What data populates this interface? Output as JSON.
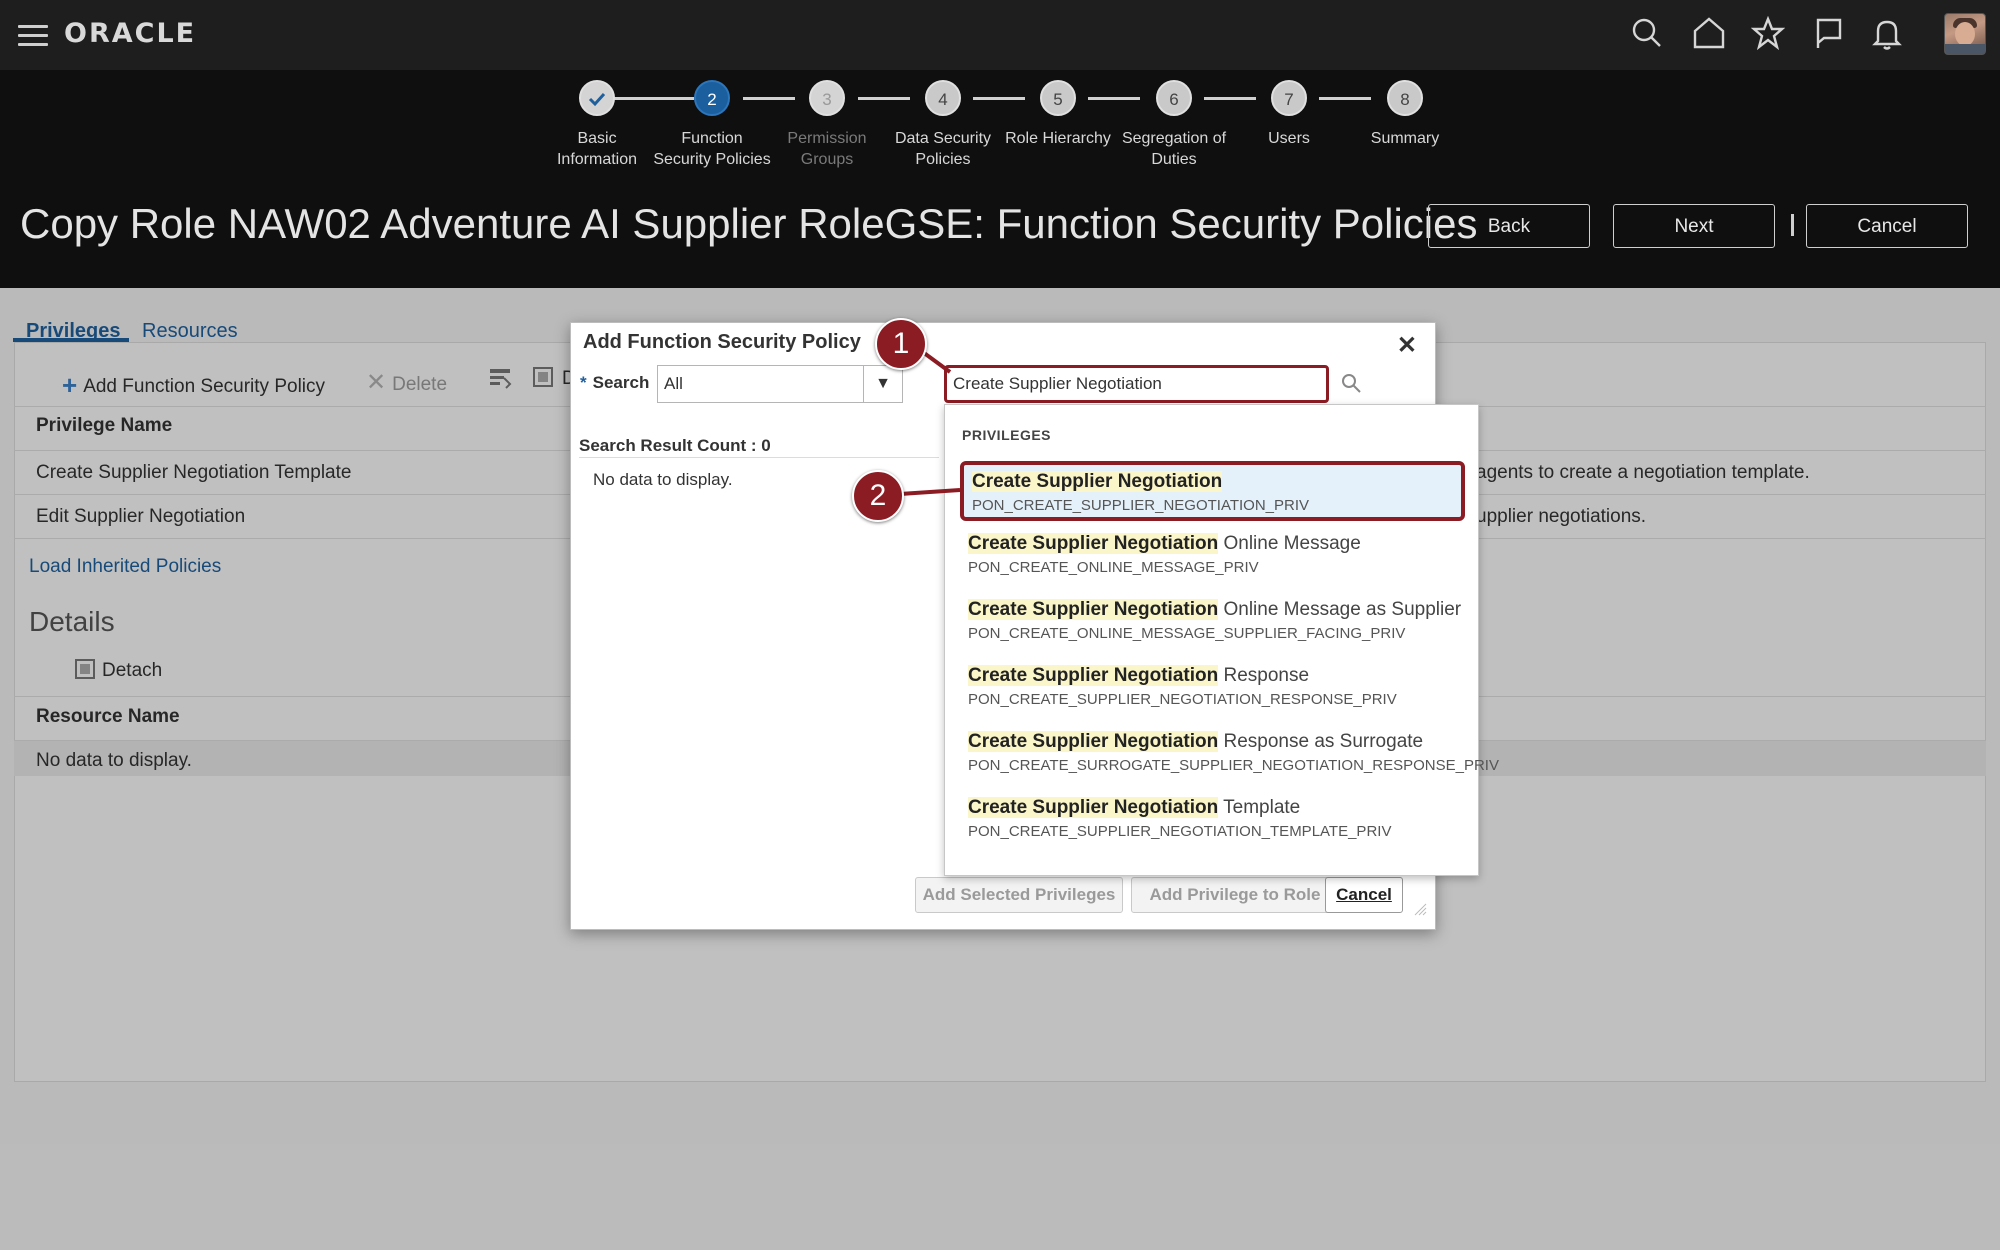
{
  "topbar": {
    "logo": "ORACLE",
    "icons": [
      "hamburger-menu-icon",
      "search-icon",
      "home-icon",
      "star-icon",
      "flag-icon",
      "bell-icon",
      "user-avatar"
    ]
  },
  "train": {
    "steps": [
      {
        "num": "",
        "label1": "Basic",
        "label2": "Information",
        "state": "done"
      },
      {
        "num": "2",
        "label1": "Function",
        "label2": "Security Policies",
        "state": "active"
      },
      {
        "num": "3",
        "label1": "Permission",
        "label2": "Groups",
        "state": "disabled"
      },
      {
        "num": "4",
        "label1": "Data Security",
        "label2": "Policies",
        "state": "normal"
      },
      {
        "num": "5",
        "label1": "Role Hierarchy",
        "label2": "",
        "state": "normal"
      },
      {
        "num": "6",
        "label1": "Segregation of",
        "label2": "Duties",
        "state": "normal"
      },
      {
        "num": "7",
        "label1": "Users",
        "label2": "",
        "state": "normal"
      },
      {
        "num": "8",
        "label1": "Summary",
        "label2": "",
        "state": "normal"
      }
    ]
  },
  "header": {
    "title": "Copy Role NAW02 Adventure AI Supplier RoleGSE: Function Security Policies",
    "back_label": "Back",
    "next_label": "Next",
    "cancel_label": "Cancel"
  },
  "tabs": {
    "privileges": "Privileges",
    "resources": "Resources"
  },
  "toolbar": {
    "add": "Add Function Security Policy",
    "delete": "Delete",
    "detach_short": "D"
  },
  "privileges_table": {
    "header": "Privilege Name",
    "rows": [
      {
        "name": "Create Supplier Negotiation Template",
        "desc": "agents to create a negotiation template."
      },
      {
        "name": "Edit Supplier Negotiation",
        "desc": "upplier negotiations."
      }
    ],
    "load_inherited": "Load Inherited Policies"
  },
  "details": {
    "title": "Details",
    "detach": "Detach",
    "resource_header": "Resource Name",
    "no_data": "No data to display."
  },
  "dialog": {
    "title": "Add Function Security Policy",
    "search_label": "Search",
    "search_select": "All",
    "search_value": "Create Supplier Negotiation",
    "result_count": "Search Result Count : 0",
    "no_data": "No data to display.",
    "add_selected": "Add Selected Privileges",
    "add_to_role": "Add Privilege to Role",
    "cancel": "Cancel"
  },
  "dropdown": {
    "header": "PRIVILEGES",
    "items": [
      {
        "hl": "Create Supplier Negotiation",
        "rest": "",
        "code": "PON_CREATE_SUPPLIER_NEGOTIATION_PRIV"
      },
      {
        "hl": "Create Supplier Negotiation",
        "rest": " Online Message",
        "code": "PON_CREATE_ONLINE_MESSAGE_PRIV"
      },
      {
        "hl": "Create Supplier Negotiation",
        "rest": " Online Message as Supplier",
        "code": "PON_CREATE_ONLINE_MESSAGE_SUPPLIER_FACING_PRIV"
      },
      {
        "hl": "Create Supplier Negotiation",
        "rest": " Response",
        "code": "PON_CREATE_SUPPLIER_NEGOTIATION_RESPONSE_PRIV"
      },
      {
        "hl": "Create Supplier Negotiation",
        "rest": " Response as Surrogate",
        "code": "PON_CREATE_SURROGATE_SUPPLIER_NEGOTIATION_RESPONSE_PRIV"
      },
      {
        "hl": "Create Supplier Negotiation",
        "rest": " Template",
        "code": "PON_CREATE_SUPPLIER_NEGOTIATION_TEMPLATE_PRIV"
      }
    ]
  },
  "callouts": [
    "1",
    "2"
  ],
  "colors": {
    "accent": "#1f5f9c",
    "callout": "#8c1c24",
    "highlight": "#fbf6c9",
    "selected_bg": "#e4f1fa"
  }
}
